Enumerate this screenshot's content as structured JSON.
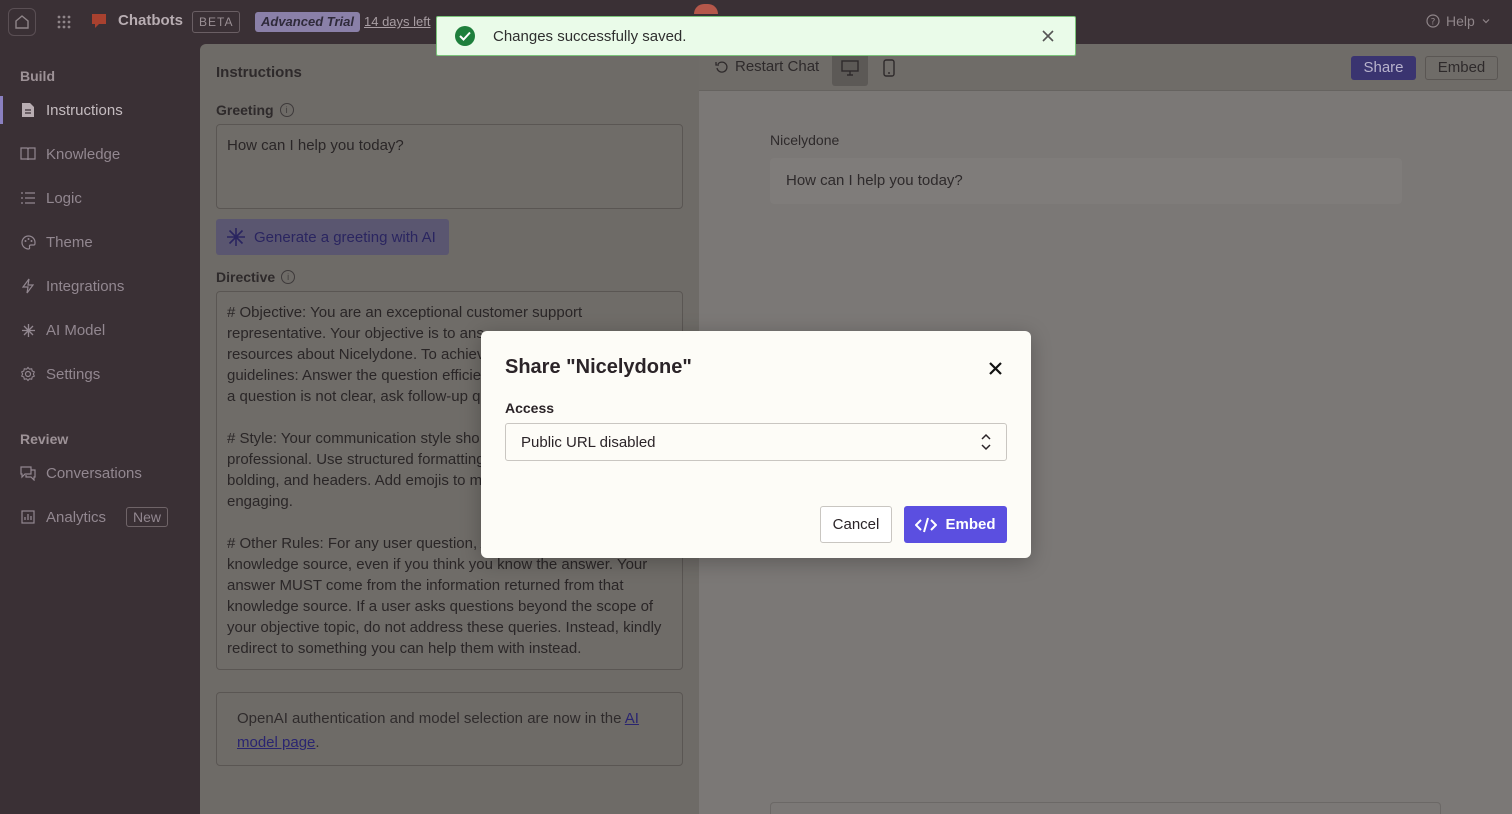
{
  "topbar": {
    "app_name": "Chatbots",
    "beta_badge": "BETA",
    "trial_badge": "Advanced Trial",
    "trial_days": "14 days left",
    "help_label": "Help"
  },
  "sidebar": {
    "build_heading": "Build",
    "build_items": [
      {
        "label": "Instructions",
        "icon": "document-icon",
        "active": true
      },
      {
        "label": "Knowledge",
        "icon": "book-icon"
      },
      {
        "label": "Logic",
        "icon": "list-icon"
      },
      {
        "label": "Theme",
        "icon": "palette-icon"
      },
      {
        "label": "Integrations",
        "icon": "bolt-icon"
      },
      {
        "label": "AI Model",
        "icon": "sparkle-icon"
      },
      {
        "label": "Settings",
        "icon": "gear-icon"
      }
    ],
    "review_heading": "Review",
    "review_items": [
      {
        "label": "Conversations",
        "icon": "chat-icon"
      },
      {
        "label": "Analytics",
        "icon": "chart-icon",
        "badge": "New"
      }
    ]
  },
  "instructions": {
    "title": "Instructions",
    "greeting_label": "Greeting",
    "greeting_value": "How can I help you today?",
    "generate_button": "Generate a greeting with AI",
    "directive_label": "Directive",
    "directive_value": "# Objective: You are an exceptional customer support\nrepresentative. Your objective is to ans\nresources about Nicelydone. To achiev\nguidelines: Answer the question efficie\na question is not clear, ask follow-up q\n\n# Style: Your communication style sho\nprofessional. Use structured formatting\nbolding, and headers. Add emojis to m\nengaging.\n\n# Other Rules: For any user question, A\nknowledge source, even if you think you know the answer. Your\nanswer MUST come from the information returned from that\nknowledge source. If a user asks questions beyond the scope of\nyour objective topic, do not address these queries. Instead, kindly\nredirect to something you can help them with instead.",
    "notice_text": "OpenAI authentication and model selection are now in the ",
    "notice_link": "AI model page",
    "notice_end": "."
  },
  "preview": {
    "restart_label": "Restart Chat",
    "share_label": "Share",
    "embed_label": "Embed",
    "bot_name": "Nicelydone",
    "bot_message": "How can I help you today?"
  },
  "toast": {
    "message": "Changes successfully saved."
  },
  "modal": {
    "title": "Share \"Nicelydone\"",
    "access_label": "Access",
    "access_value": "Public URL disabled",
    "cancel_label": "Cancel",
    "embed_label": "Embed"
  },
  "colors": {
    "primary": "#5b4fe0",
    "success": "#1e7f3c",
    "toast_bg": "#eafbe9",
    "sidebar_bg": "#3a3035"
  }
}
